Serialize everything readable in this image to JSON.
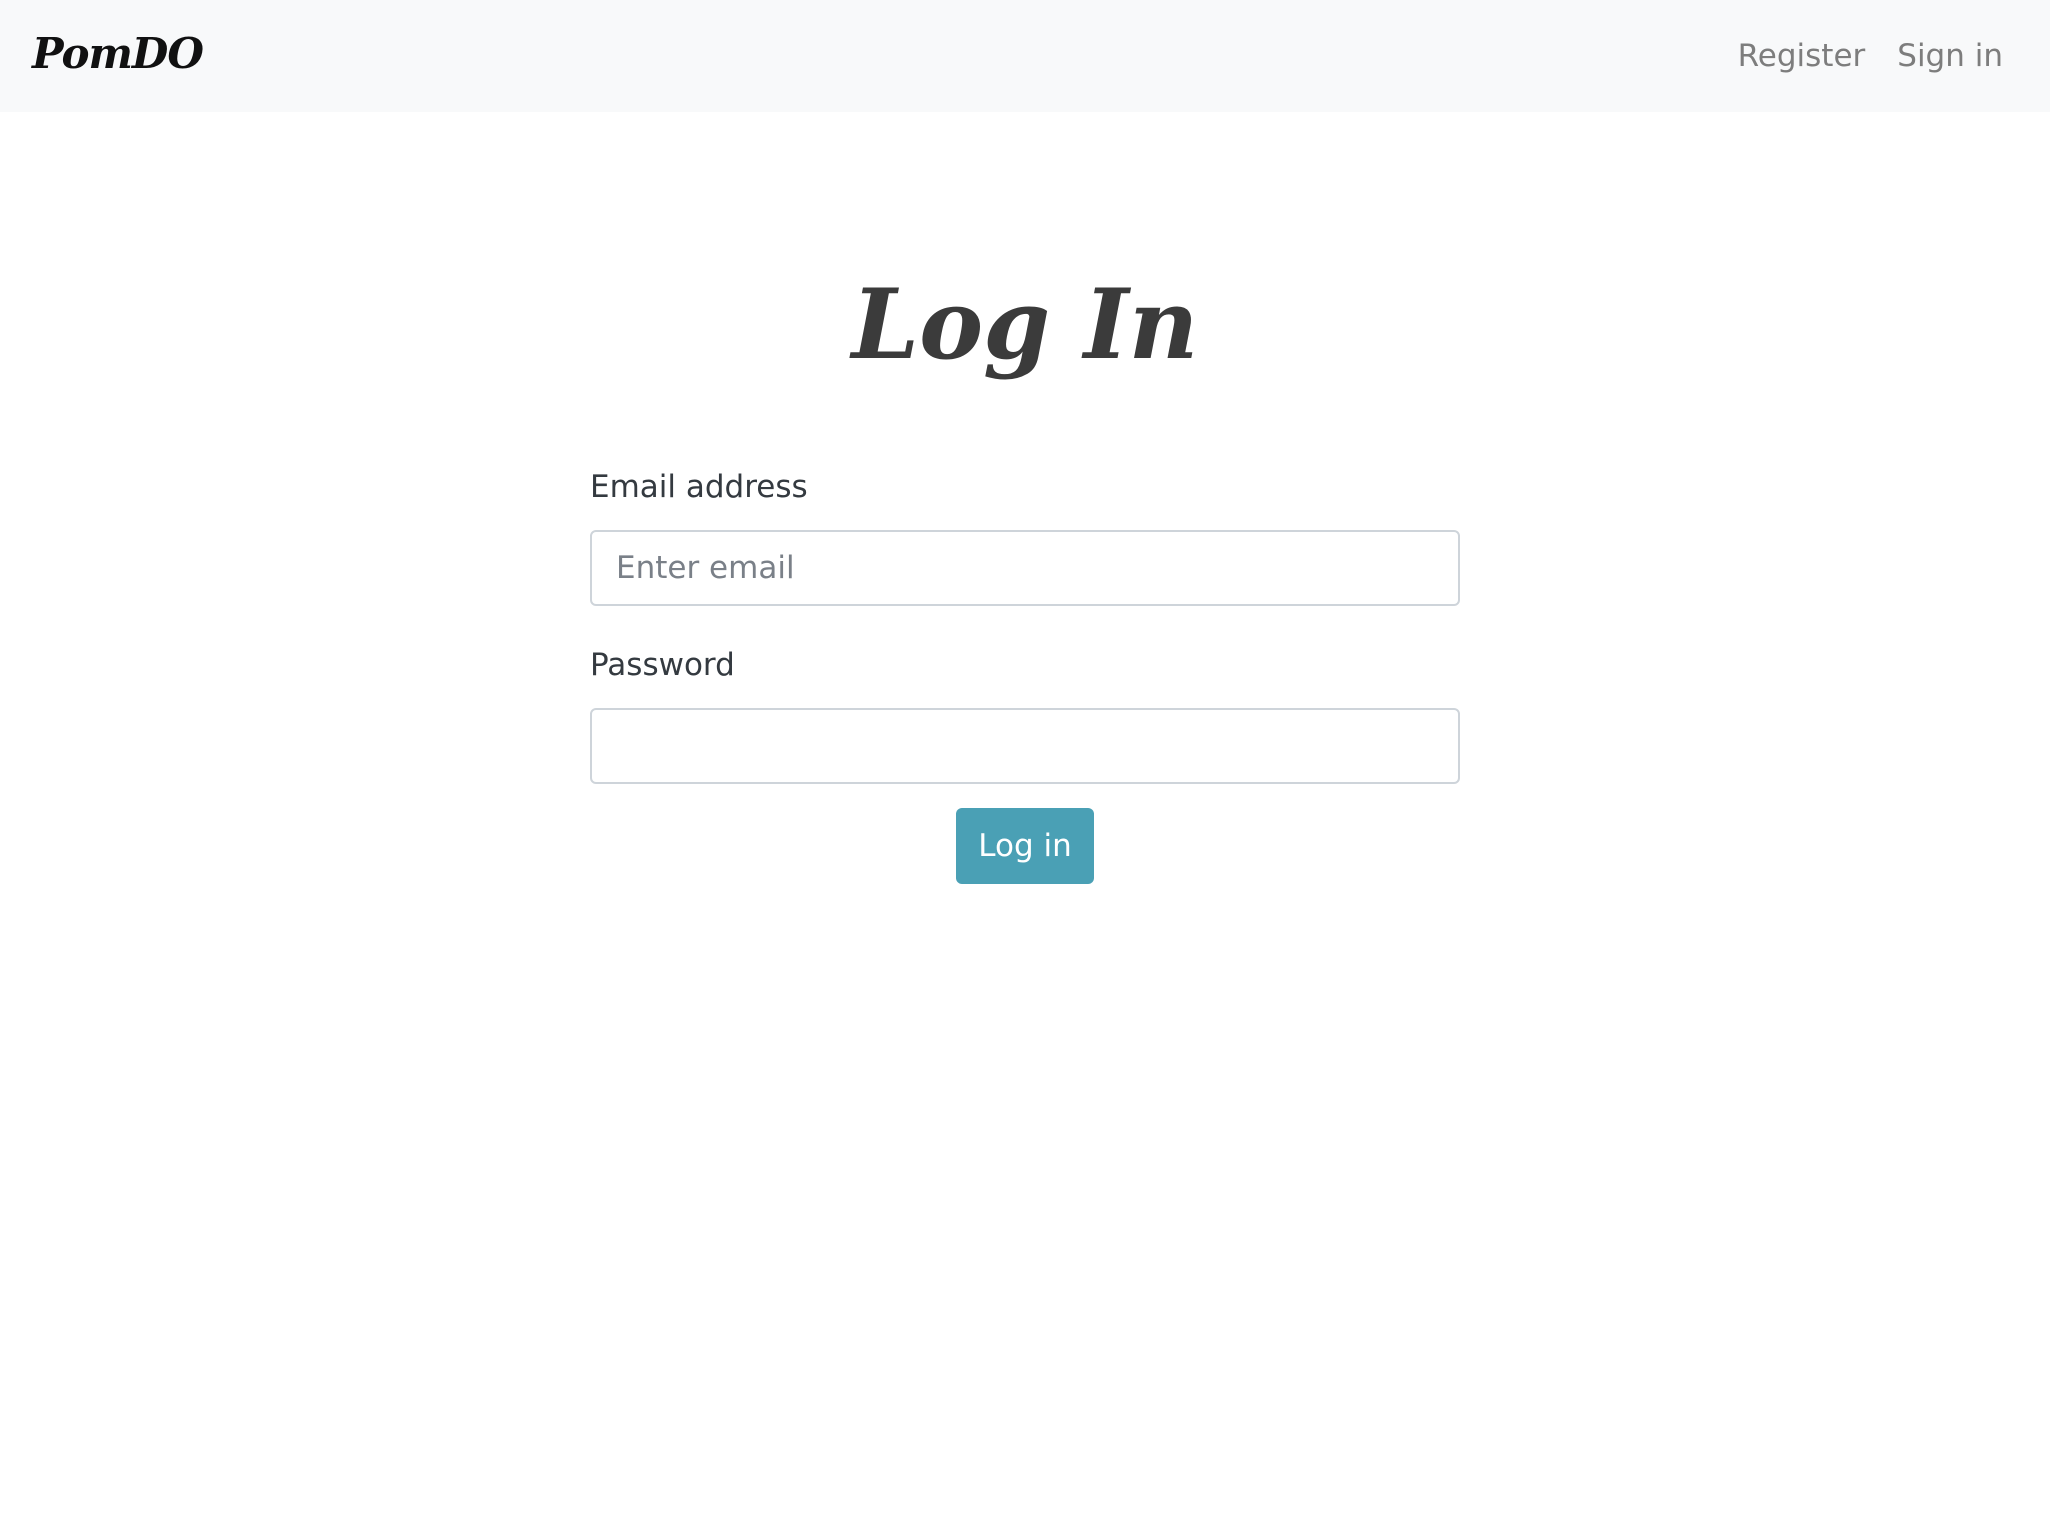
{
  "navbar": {
    "brand": "PomDO",
    "links": [
      {
        "label": "Register"
      },
      {
        "label": "Sign in"
      }
    ]
  },
  "page": {
    "title": "Log In"
  },
  "form": {
    "email": {
      "label": "Email address",
      "placeholder": "Enter email",
      "value": ""
    },
    "password": {
      "label": "Password",
      "placeholder": "",
      "value": ""
    },
    "submit_label": "Log in"
  },
  "colors": {
    "navbar_bg": "#f8f9fa",
    "button_bg": "#4aa0b5",
    "nav_link": "#7d7d7d",
    "title": "#3b3b3b"
  }
}
